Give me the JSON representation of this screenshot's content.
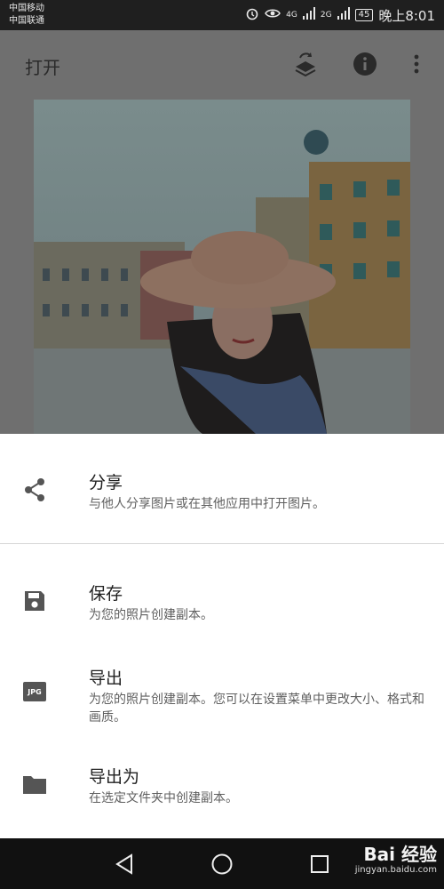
{
  "status_bar": {
    "carrier_1": "中国移动",
    "carrier_2": "中国联通",
    "signal_1": "4G",
    "signal_2": "2G",
    "battery": "45",
    "time": "晚上8:01"
  },
  "app_bar": {
    "title": "打开",
    "icons": [
      "layers-swap-icon",
      "info-icon",
      "more-vert-icon"
    ]
  },
  "sheet": {
    "share": {
      "title": "分享",
      "desc": "与他人分享图片或在其他应用中打开图片。",
      "icon": "share-icon"
    },
    "save": {
      "title": "保存",
      "desc": "为您的照片创建副本。",
      "icon": "save-icon"
    },
    "export": {
      "title": "导出",
      "desc": "为您的照片创建副本。您可以在设置菜单中更改大小、格式和画质。",
      "icon": "jpg-icon",
      "badge": "JPG"
    },
    "export_as": {
      "title": "导出为",
      "desc": "在选定文件夹中创建副本。",
      "icon": "folder-icon"
    }
  },
  "nav_bar": {
    "buttons": [
      "back-icon",
      "home-icon",
      "recents-icon"
    ]
  },
  "watermark": {
    "brand": "Bai 经验",
    "site": "jingyan.baidu.com"
  },
  "colors": {
    "scrim": "#6f6f6f",
    "status_bar": "#1f1f1f",
    "nav_bar": "#111111",
    "icon_grey": "#555555"
  }
}
